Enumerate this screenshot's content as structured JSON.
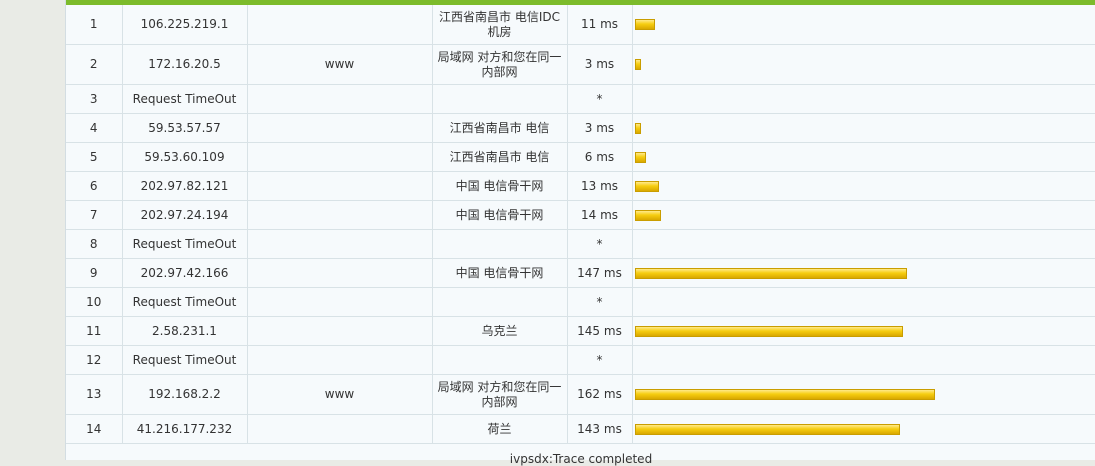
{
  "rows": [
    {
      "hop": "1",
      "ip": "106.225.219.1",
      "host": "",
      "loc": "江西省南昌市 电信IDC机房",
      "time": "11 ms",
      "ms": 11,
      "tall": true
    },
    {
      "hop": "2",
      "ip": "172.16.20.5",
      "host": "www",
      "loc": "局域网 对方和您在同一内部网",
      "time": "3 ms",
      "ms": 3,
      "tall": true
    },
    {
      "hop": "3",
      "ip": "Request TimeOut",
      "host": "",
      "loc": "",
      "time": "*",
      "ms": 0,
      "tall": false
    },
    {
      "hop": "4",
      "ip": "59.53.57.57",
      "host": "",
      "loc": "江西省南昌市 电信",
      "time": "3 ms",
      "ms": 3,
      "tall": false
    },
    {
      "hop": "5",
      "ip": "59.53.60.109",
      "host": "",
      "loc": "江西省南昌市 电信",
      "time": "6 ms",
      "ms": 6,
      "tall": false
    },
    {
      "hop": "6",
      "ip": "202.97.82.121",
      "host": "",
      "loc": "中国 电信骨干网",
      "time": "13 ms",
      "ms": 13,
      "tall": false
    },
    {
      "hop": "7",
      "ip": "202.97.24.194",
      "host": "",
      "loc": "中国 电信骨干网",
      "time": "14 ms",
      "ms": 14,
      "tall": false
    },
    {
      "hop": "8",
      "ip": "Request TimeOut",
      "host": "",
      "loc": "",
      "time": "*",
      "ms": 0,
      "tall": false
    },
    {
      "hop": "9",
      "ip": "202.97.42.166",
      "host": "",
      "loc": "中国 电信骨干网",
      "time": "147 ms",
      "ms": 147,
      "tall": false
    },
    {
      "hop": "10",
      "ip": "Request TimeOut",
      "host": "",
      "loc": "",
      "time": "*",
      "ms": 0,
      "tall": false
    },
    {
      "hop": "11",
      "ip": "2.58.231.1",
      "host": "",
      "loc": "乌克兰",
      "time": "145 ms",
      "ms": 145,
      "tall": false
    },
    {
      "hop": "12",
      "ip": "Request TimeOut",
      "host": "",
      "loc": "",
      "time": "*",
      "ms": 0,
      "tall": false
    },
    {
      "hop": "13",
      "ip": "192.168.2.2",
      "host": "www",
      "loc": "局域网 对方和您在同一内部网",
      "time": "162 ms",
      "ms": 162,
      "tall": true
    },
    {
      "hop": "14",
      "ip": "41.216.177.232",
      "host": "",
      "loc": "荷兰",
      "time": "143 ms",
      "ms": 143,
      "tall": false
    }
  ],
  "footer_text": "ivpsdx:Trace completed",
  "colors": {
    "accent": "#7cbb2b",
    "bar": "#f6cd10",
    "panel": "#f6fafc"
  }
}
